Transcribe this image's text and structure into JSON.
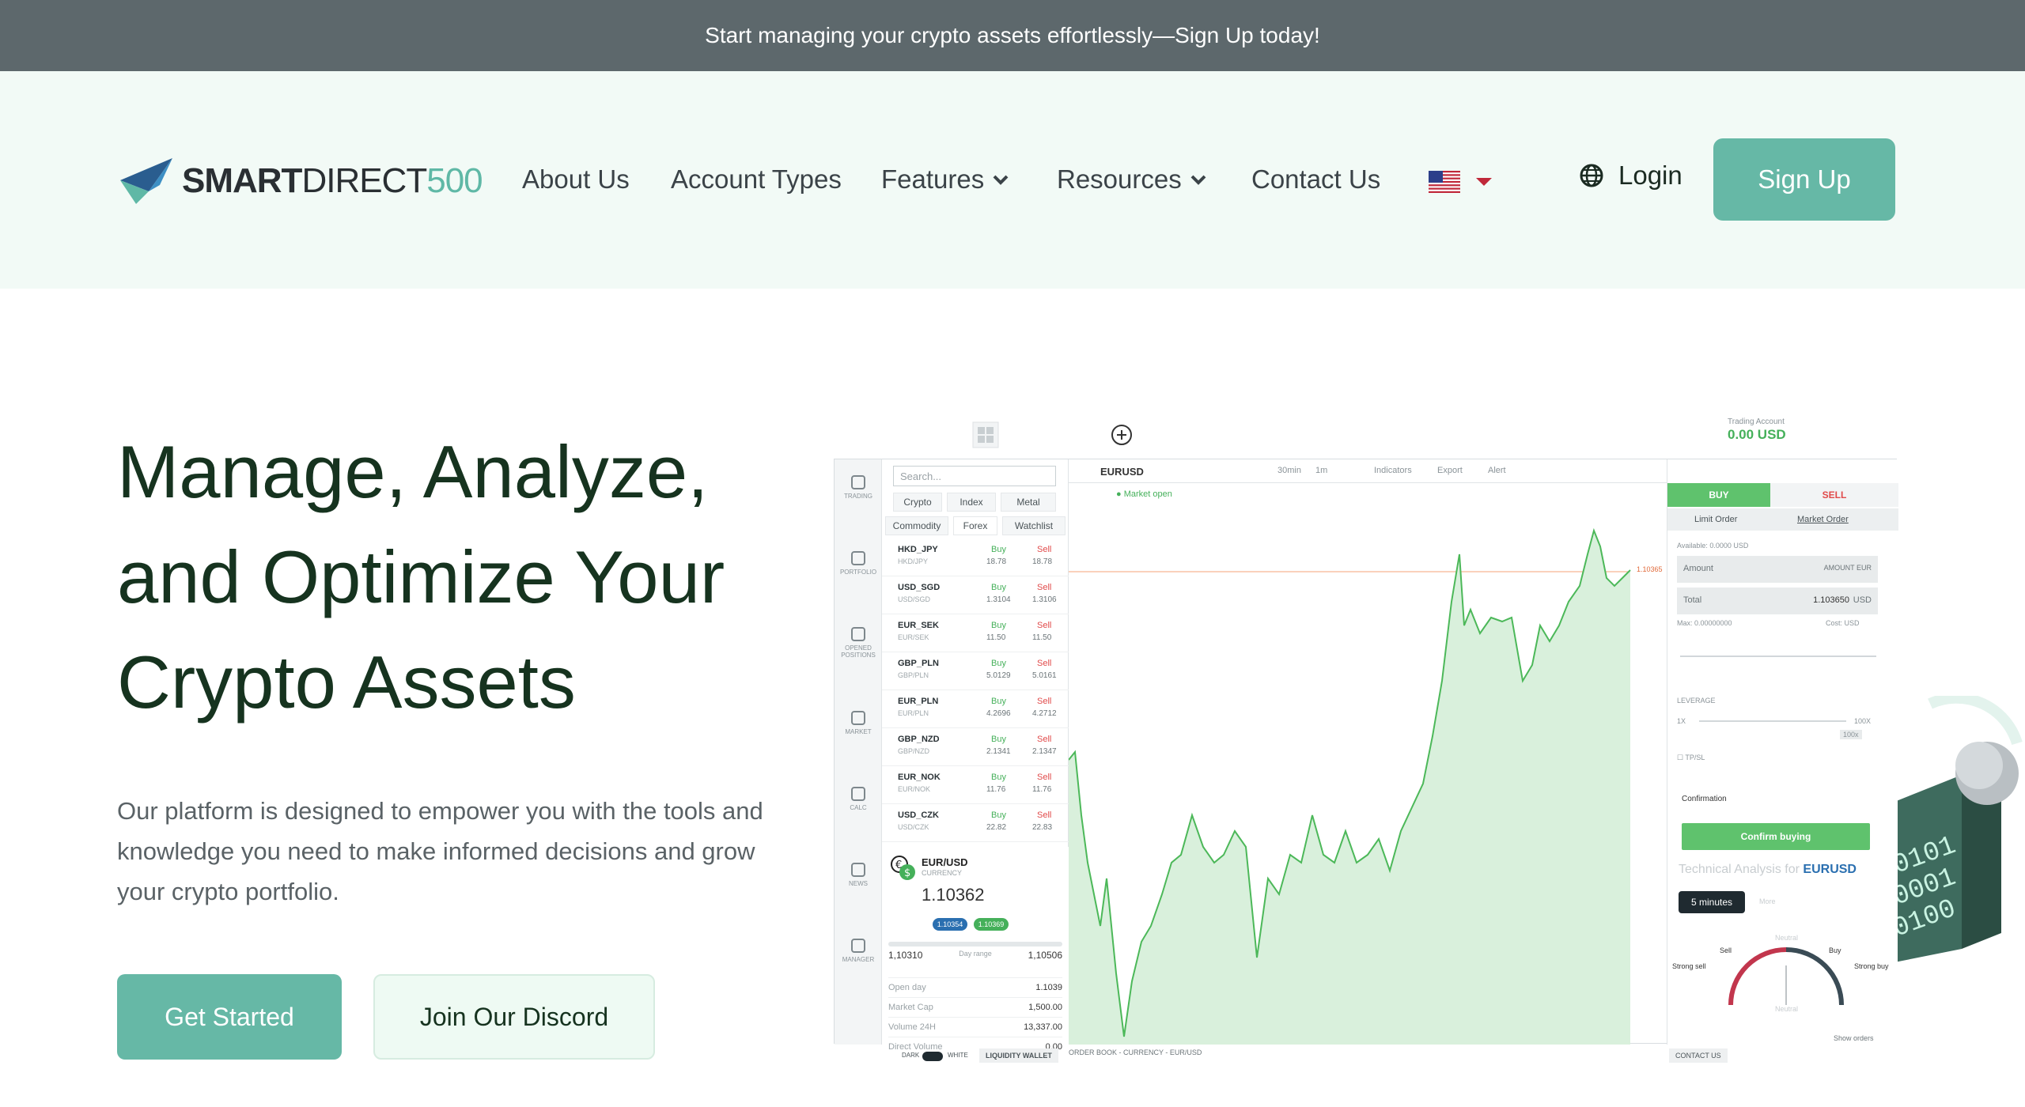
{
  "banner": {
    "text": "Start managing your crypto assets effortlessly—Sign Up today!"
  },
  "logo": {
    "smart": "SMART",
    "direct": "DIRECT",
    "num": "500"
  },
  "nav": {
    "about": "About Us",
    "account_types": "Account Types",
    "features": "Features",
    "resources": "Resources",
    "contact": "Contact Us",
    "login": "Login",
    "signup": "Sign Up"
  },
  "hero": {
    "title_line1": "Manage, Analyze,",
    "title_line2": "and Optimize Your",
    "title_line3": "Crypto Assets",
    "description": "Our platform is designed to empower you with the tools and knowledge you need to make informed decisions and grow your crypto portfolio.",
    "cta_primary": "Get Started",
    "cta_secondary": "Join Our Discord"
  },
  "app": {
    "trading_account_label": "Trading Account",
    "trading_account_value": "0.00 USD",
    "sidebar": [
      "TRADING",
      "PORTFOLIO",
      "OPENED POSITIONS",
      "MARKET",
      "CALC",
      "NEWS",
      "MANAGER"
    ],
    "search_placeholder": "Search...",
    "tabs": [
      "Crypto",
      "Index",
      "Metal",
      "Commodity",
      "Forex",
      "Watchlist"
    ],
    "pairs": [
      {
        "sym": "HKD_JPY",
        "sub": "HKD/JPY",
        "buy": "18.78",
        "sell": "18.78"
      },
      {
        "sym": "USD_SGD",
        "sub": "USD/SGD",
        "buy": "1.3104",
        "sell": "1.3106"
      },
      {
        "sym": "EUR_SEK",
        "sub": "EUR/SEK",
        "buy": "11.50",
        "sell": "11.50"
      },
      {
        "sym": "GBP_PLN",
        "sub": "GBP/PLN",
        "buy": "5.0129",
        "sell": "5.0161"
      },
      {
        "sym": "EUR_PLN",
        "sub": "EUR/PLN",
        "buy": "4.2696",
        "sell": "4.2712"
      },
      {
        "sym": "GBP_NZD",
        "sub": "GBP/NZD",
        "buy": "2.1341",
        "sell": "2.1347"
      },
      {
        "sym": "EUR_NOK",
        "sub": "EUR/NOK",
        "buy": "11.76",
        "sell": "11.76"
      },
      {
        "sym": "USD_CZK",
        "sub": "USD/CZK",
        "buy": "22.82",
        "sell": "22.83"
      }
    ],
    "buy_label": "Buy",
    "sell_label": "Sell",
    "detail": {
      "symbol": "EUR/USD",
      "category": "CURRENCY",
      "price": "1.10362",
      "bid": "1.10354",
      "ask": "1.10369",
      "range_low": "1,10310",
      "range_label": "Day range",
      "range_high": "1,10506",
      "stats": [
        {
          "label": "Open day",
          "value": "1.1039"
        },
        {
          "label": "Market Cap",
          "value": "1,500.00"
        },
        {
          "label": "Volume 24H",
          "value": "13,337.00"
        },
        {
          "label": "Direct Volume",
          "value": "0.00"
        }
      ]
    },
    "chart": {
      "symbol": "EURUSD",
      "status": "Market open",
      "timeframe": "30min",
      "interval": "1m",
      "indicators": "Indicators",
      "export": "Export",
      "alert": "Alert",
      "last_price": "1.10365",
      "footer": "ORDER BOOK - CURRENCY - EUR/USD"
    },
    "order": {
      "buy": "BUY",
      "sell": "SELL",
      "limit": "Limit Order",
      "market": "Market Order",
      "available": "Available: 0.0000 USD",
      "amount": "Amount",
      "amount_unit": "AMOUNT EUR",
      "total": "Total",
      "total_val": "1.103650",
      "total_unit": "USD",
      "max": "Max: 0.00000000",
      "cost": "Cost: USD",
      "leverage": "LEVERAGE",
      "lev_min": "1X",
      "lev_max": "100X",
      "lev_val": "100x",
      "tpsl": "TP/SL",
      "confirmation": "Confirmation",
      "confirm_btn": "Confirm buying",
      "tech_prefix": "Technical Analysis for",
      "tech_sym": "EURUSD",
      "timeframe": "5 minutes",
      "more": "More",
      "gauge_neutral": "Neutral",
      "gauge_sell": "Sell",
      "gauge_buy": "Buy",
      "gauge_strong_sell": "Strong sell",
      "gauge_strong_buy": "Strong buy"
    },
    "bottom": {
      "dark": "DARK",
      "white": "WHITE",
      "wallet": "LIQUIDITY WALLET",
      "contact": "CONTACT US",
      "show_orders": "Show orders"
    }
  },
  "colors": {
    "accent": "#66b8a6",
    "banner": "#5d686c",
    "header_bg": "#f2faf6",
    "title": "#16331f"
  }
}
